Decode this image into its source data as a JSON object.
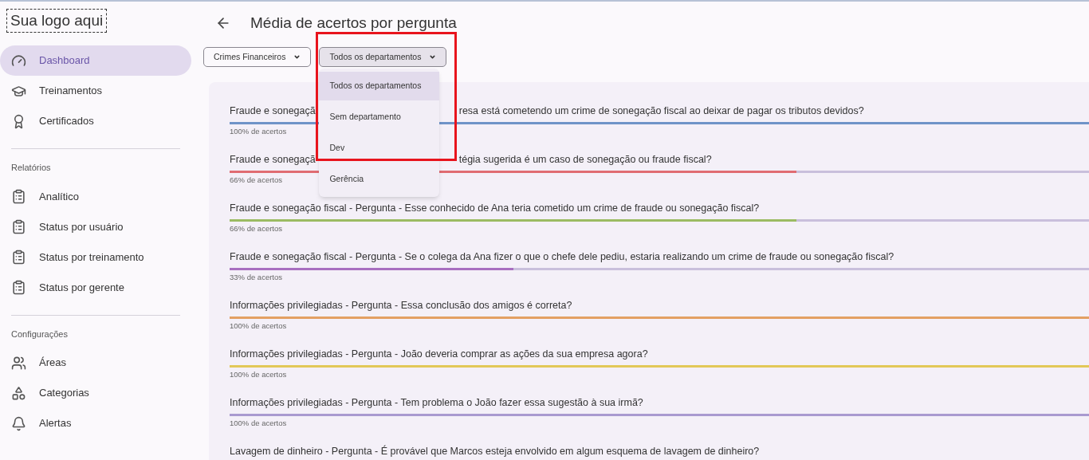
{
  "logo": "Sua logo aqui",
  "sidebar": {
    "items": [
      {
        "label": "Dashboard",
        "selected": true
      },
      {
        "label": "Treinamentos",
        "selected": false
      },
      {
        "label": "Certificados",
        "selected": false
      }
    ],
    "sections": [
      {
        "title": "Relatórios",
        "items": [
          {
            "label": "Analítico",
            "selected": false
          },
          {
            "label": "Status por usuário",
            "selected": false
          },
          {
            "label": "Status por treinamento",
            "selected": false
          },
          {
            "label": "Status por gerente",
            "selected": false
          }
        ]
      },
      {
        "title": "Configurações",
        "items": [
          {
            "label": "Áreas",
            "selected": false
          },
          {
            "label": "Categorias",
            "selected": false
          },
          {
            "label": "Alertas",
            "selected": false
          }
        ]
      }
    ]
  },
  "page_title": "Média de acertos por pergunta",
  "filters": [
    {
      "value": "Crimes Financeiros",
      "open": false
    },
    {
      "value": "Todos os departamentos",
      "open": true,
      "options": [
        {
          "label": "Todos os departamentos",
          "selected": true
        },
        {
          "label": "Sem departamento",
          "selected": false
        },
        {
          "label": "Dev",
          "selected": false
        },
        {
          "label": "Gerência",
          "selected": false
        }
      ]
    }
  ],
  "questions": [
    {
      "title_parts": [
        "Fraude e sonegaçã",
        "resa está cometendo um crime de sonegação fiscal ao deixar de pagar os tributos devidos?"
      ],
      "level": 1,
      "caption": "100% de acertos",
      "color": "#6f93c8"
    },
    {
      "title_parts": [
        "Fraude e sonegaçã",
        "tégia sugerida é um caso de sonegação ou fraude fiscal?"
      ],
      "level": 0.66,
      "caption": "66% de acertos",
      "color": "#e06c72"
    },
    {
      "title_parts": [
        "Fraude e sonegação fiscal - Pergunta - Esse conhecido de Ana teria cometido um crime de fraude ou sonegação fiscal?"
      ],
      "level": 0.66,
      "caption": "66% de acertos",
      "color": "#9bbb63"
    },
    {
      "title_parts": [
        "Fraude e sonegação fiscal - Pergunta - Se o colega da Ana fizer o que o chefe dele pediu, estaria realizando um crime de fraude ou sonegação fiscal?"
      ],
      "level": 0.33,
      "caption": "33% de acertos",
      "color": "#a86fc0"
    },
    {
      "title_parts": [
        "Informações privilegiadas - Pergunta - Essa conclusão dos amigos é correta?"
      ],
      "level": 1,
      "caption": "100% de acertos",
      "color": "#e3a063"
    },
    {
      "title_parts": [
        "Informações privilegiadas - Pergunta - João deveria comprar as ações da sua empresa agora?"
      ],
      "level": 1,
      "caption": "100% de acertos",
      "color": "#e2c858"
    },
    {
      "title_parts": [
        "Informações privilegiadas - Pergunta - Tem problema o João fazer essa sugestão à sua irmã?"
      ],
      "level": 1,
      "caption": "100% de acertos",
      "color": "#a99ad0"
    },
    {
      "title_parts": [
        "Lavagem de dinheiro - Pergunta - É provável que Marcos esteja envolvido em algum esquema de lavagem de dinheiro?"
      ]
    }
  ]
}
